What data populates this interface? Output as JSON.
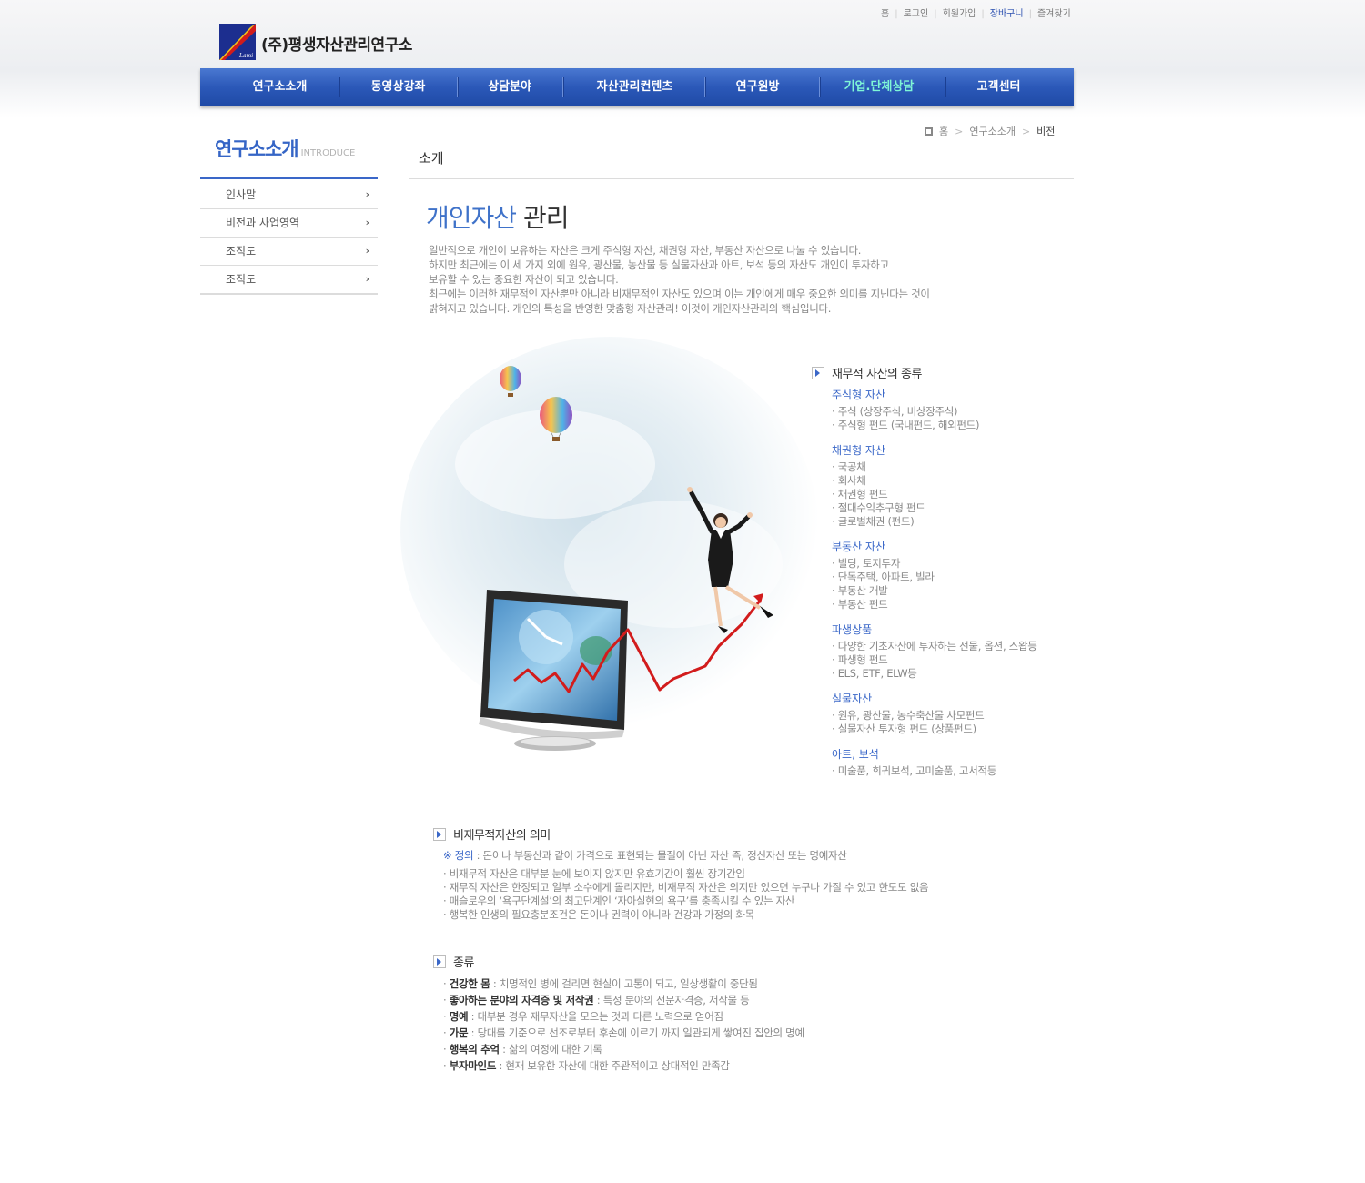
{
  "top_links": [
    "홈",
    "로그인",
    "회원가입",
    "장바구니",
    "즐겨찾기"
  ],
  "logo": {
    "text": "(주)평생자산관리연구소",
    "mark_text": "Lami"
  },
  "gnb": [
    "연구소소개",
    "동영상강좌",
    "상담분야",
    "자산관리컨텐츠",
    "연구원방",
    "기업.단체상담",
    "고객센터"
  ],
  "lnb": {
    "title": "연구소소개",
    "title_en": "INTRODUCE",
    "items": [
      "인사말",
      "비전과 사업영역",
      "조직도",
      "조직도"
    ]
  },
  "breadcrumb": [
    "홈",
    "연구소소개",
    "비전"
  ],
  "page_title": "소개",
  "heading": {
    "blue": "개인자산",
    "dark": "관리"
  },
  "intro": [
    "일반적으로 개인이 보유하는 자산은 크게 주식형 자산, 채권형 자산, 부동산 자산으로 나눌 수 있습니다.",
    "하지만 최근에는 이 세 가지 외에 원유, 광산물, 농산물 등 실물자산과 아트, 보석 등의 자산도 개인이 투자하고",
    "보유할 수 있는 중요한 자산이 되고 있습니다.",
    "최근에는 이러한 재무적인 자산뿐만 아니라 비재무적인 자산도 있으며 이는 개인에게 매우 중요한 의미를 지닌다는 것이",
    "밝혀지고 있습니다. 개인의 특성을 반영한 맞춤형 자산관리! 이것이 개인자산관리의 핵심입니다."
  ],
  "financial": {
    "title": "재무적 자산의 종류",
    "groups": [
      {
        "name": "주식형 자산",
        "items": [
          "· 주식 (상장주식, 비상장주식)",
          "· 주식형 펀드 (국내펀드, 해외펀드)"
        ]
      },
      {
        "name": "채권형 자산",
        "items": [
          "· 국공채",
          "· 회사채",
          "· 채권형 펀드",
          "· 절대수익추구형 펀드",
          "· 글로벌채권 (펀드)"
        ]
      },
      {
        "name": "부동산 자산",
        "items": [
          "· 빌딩, 토지투자",
          "· 단독주택, 아파트, 빌라",
          "· 부동산 개발",
          "· 부동산 펀드"
        ]
      },
      {
        "name": "파생상품",
        "items": [
          "· 다양한 기초자산에 투자하는 선물, 옵션, 스왑등",
          "· 파생형 펀드",
          "· ELS, ETF, ELW등"
        ]
      },
      {
        "name": "실물자산",
        "items": [
          "· 원유, 광산물, 농수축산물 사모펀드",
          "· 실물자산 투자형 펀드 (상품펀드)"
        ]
      },
      {
        "name": "아트, 보석",
        "items": [
          "· 미술품, 희귀보석, 고미술품, 고서적등"
        ]
      }
    ]
  },
  "nonfinancial": {
    "title": "비재무적자산의 의미",
    "def_mark": "※ 정의",
    "def_text": " : 돈이나 부동산과 같이 가격으로 표현되는 물질이 아닌 자산 즉, 정신자산 또는 명예자산",
    "items": [
      "· 비재무적 자산은 대부분 눈에 보이지 않지만 유효기간이 훨씬 장기간임",
      "· 재무적 자산은 한정되고 일부 소수에게 몰리지만, 비재무적 자산은 의지만 있으면 누구나 가질 수 있고 한도도 없음",
      "· 매슬로우의 ‘욕구단계설’의 최고단계인 ‘자아실현의 욕구’를 충족시킬 수 있는 자산",
      "· 행복한 인생의 필요충분조건은 돈이나 권력이 아니라 건강과 가정의 화목"
    ]
  },
  "kinds": {
    "title": "종류",
    "items": [
      {
        "term": "건강한 몸",
        "desc": " : 치명적인 병에 걸리면 현실이 고통이 되고, 일상생활이 중단됨"
      },
      {
        "term": "좋아하는 분야의 자격증 및 저작권",
        "desc": " : 특정 분야의 전문자격증, 저작물 등"
      },
      {
        "term": "명예",
        "desc": " : 대부분 경우 재무자산을 모으는 것과 다른 노력으로 얻어짐"
      },
      {
        "term": "가문",
        "desc": " : 당대를 기준으로 선조로부터 후손에 이르기 까지 일관되게 쌓여진 집안의 명예"
      },
      {
        "term": "행복의 추억",
        "desc": " : 삶의 여정에 대한 기록"
      },
      {
        "term": "부자마인드",
        "desc": " : 현재 보유한 자산에 대한 주관적이고 상대적인 만족감"
      }
    ]
  },
  "colors": {
    "brand_blue": "#3a67c8",
    "nav_active": "#7ff6d6",
    "chart_line": "#d21c1c"
  }
}
